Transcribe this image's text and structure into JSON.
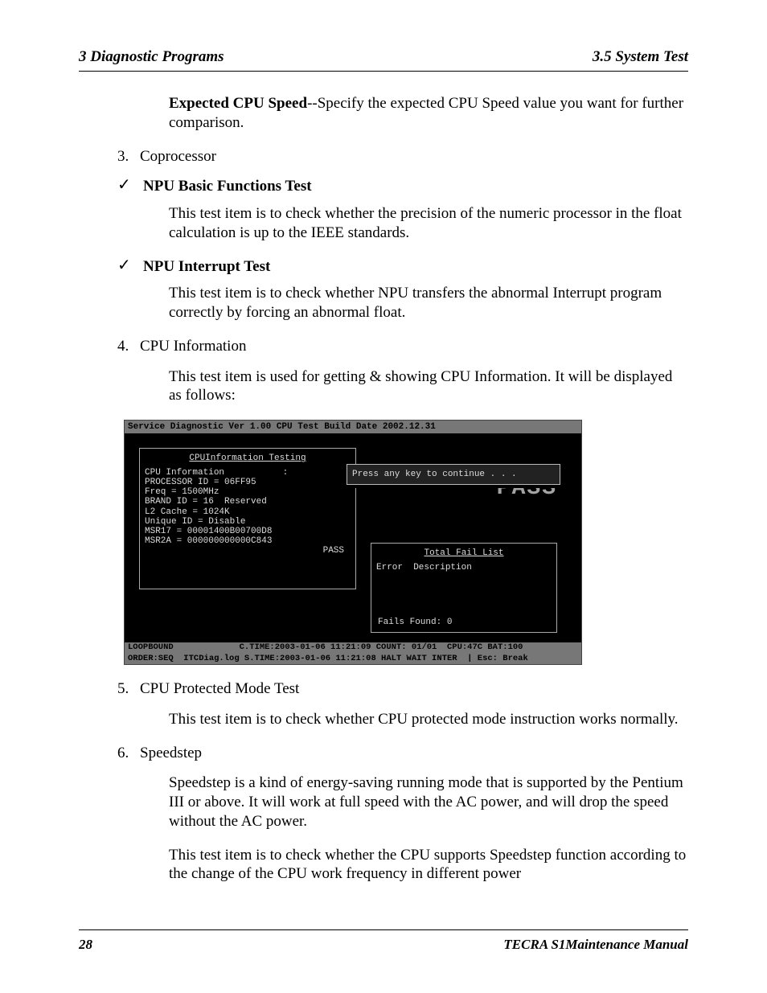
{
  "header": {
    "left": "3  Diagnostic Programs",
    "right": "3.5 System Test"
  },
  "footer": {
    "page": "28",
    "doc": "TECRA S1Maintenance Manual"
  },
  "p_expected": {
    "bold": "Expected CPU Speed",
    "rest": "--Specify the expected CPU Speed value you want for further comparison."
  },
  "list3": {
    "num": "3.",
    "label": "Coprocessor"
  },
  "npu_basic": {
    "title": "NPU Basic Functions Test",
    "body": "This test item is to check whether the precision of the numeric processor in the float calculation is up to the IEEE standards."
  },
  "npu_interrupt": {
    "title": "NPU Interrupt Test",
    "body": "This test item is to check whether NPU transfers the abnormal Interrupt program correctly by forcing an abnormal float."
  },
  "list4": {
    "num": "4.",
    "label": "CPU Information",
    "body": "This test item is used for getting & showing CPU Information. It will be displayed as follows:"
  },
  "terminal": {
    "topbar": "Service Diagnostic Ver 1.00      CPU Test    Build Date 2002.12.31",
    "left_title": "CPUInformation Testing",
    "lines": [
      "CPU Information           :",
      "PROCESSOR ID = 06FF95",
      "Freq = 1500MHz",
      "BRAND ID = 16  Reserved",
      "L2 Cache = 1024K",
      "Unique ID = Disable",
      "MSR17 = 00001400B00700D8",
      "MSR2A = 000000000000C843"
    ],
    "pass": "PASS",
    "big_pass": "PASS",
    "prompt": "Press any key to continue . . .",
    "fail_title": "Total Fail List",
    "fail_cols": "Error  Description",
    "fail_found": "Fails Found: 0",
    "status1": "LOOPBOUND             C.TIME:2003-01-06 11:21:09 COUNT: 01/01  CPU:47C BAT:100",
    "status2": "ORDER:SEQ  ITCDiag.log S.TIME:2003-01-06 11:21:08 HALT WAIT INTER  | Esc: Break"
  },
  "list5": {
    "num": "5.",
    "label": "CPU Protected Mode Test",
    "body": "This test item is to check whether CPU protected mode instruction works normally."
  },
  "list6": {
    "num": "6.",
    "label": "Speedstep",
    "body1": "Speedstep is a kind of energy-saving running mode that is supported by the Pentium III or above. It will work at full speed with the AC power, and will drop the speed without the AC power.",
    "body2": "This test item is to check whether the CPU supports Speedstep function according to the change of the CPU work frequency in different power"
  }
}
